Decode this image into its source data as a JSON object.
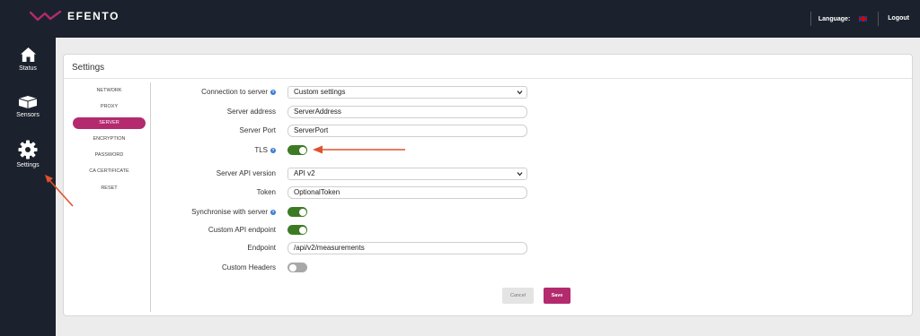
{
  "app": {
    "name": "EFENTO"
  },
  "topbar": {
    "language_label": "Language:",
    "language_flag": "uk-flag-icon",
    "logout_label": "Logout"
  },
  "sidebar": {
    "items": [
      {
        "label": "Status",
        "icon": "home-icon"
      },
      {
        "label": "Sensors",
        "icon": "sensor-icon"
      },
      {
        "label": "Settings",
        "icon": "gear-icon",
        "active": true
      }
    ]
  },
  "page": {
    "title": "Settings"
  },
  "settings_nav": {
    "items": [
      {
        "label": "NETWORK"
      },
      {
        "label": "PROXY"
      },
      {
        "label": "SERVER",
        "active": true
      },
      {
        "label": "ENCRYPTION"
      },
      {
        "label": "PASSWORD"
      },
      {
        "label": "CA CERTIFICATE"
      },
      {
        "label": "RESET"
      }
    ]
  },
  "form": {
    "connection": {
      "label": "Connection to server",
      "value": "Custom settings",
      "info": "?"
    },
    "server_address": {
      "label": "Server address",
      "value": "ServerAddress"
    },
    "server_port": {
      "label": "Server Port",
      "value": "ServerPort"
    },
    "tls": {
      "label": "TLS",
      "enabled": true,
      "info": "?"
    },
    "api_version": {
      "label": "Server API version",
      "value": "API v2"
    },
    "token": {
      "label": "Token",
      "value": "OptionalToken"
    },
    "sync": {
      "label": "Synchronise with server",
      "enabled": true,
      "info": "?"
    },
    "custom_endpoint": {
      "label": "Custom API endpoint",
      "enabled": true
    },
    "endpoint": {
      "label": "Endpoint",
      "value": "/api/v2/measurements"
    },
    "custom_headers": {
      "label": "Custom Headers",
      "enabled": false
    }
  },
  "actions": {
    "cancel_label": "Cancel",
    "save_label": "Save"
  },
  "colors": {
    "brand": "#b32a6e",
    "sidebar_bg": "#1c222d",
    "toggle_on": "#3d7a24",
    "annotation_arrow": "#e0522e"
  }
}
